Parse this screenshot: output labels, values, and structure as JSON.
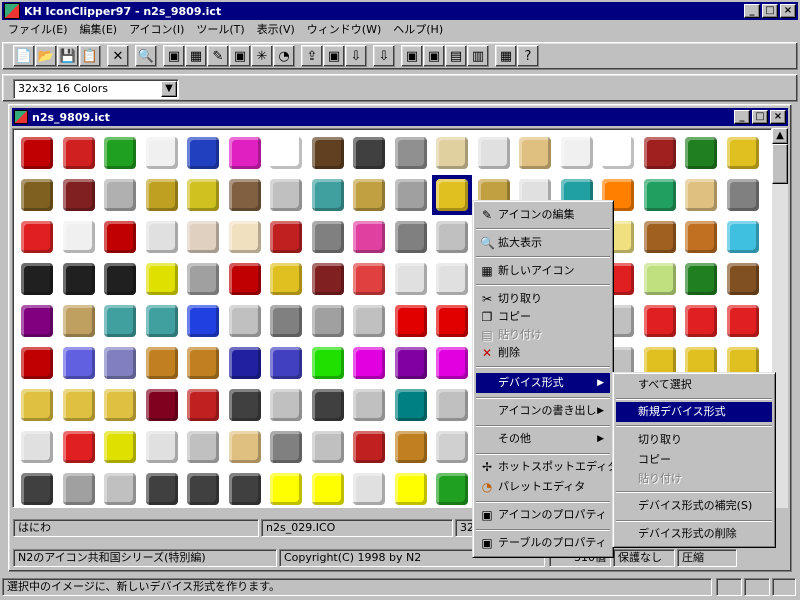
{
  "app": {
    "title": "KH IconClipper97 - n2s_9809.ict",
    "controls": [
      "_",
      "□",
      "×"
    ]
  },
  "menubar": [
    "ファイル(E)",
    "編集(E)",
    "アイコン(I)",
    "ツール(T)",
    "表示(V)",
    "ウィンドウ(W)",
    "ヘルプ(H)"
  ],
  "format_select": {
    "value": "32x32  16 Colors"
  },
  "child": {
    "title": "n2s_9809.ict",
    "controls": [
      "_",
      "□",
      "×"
    ]
  },
  "icon_rows": [
    [
      "#c00000",
      "#d02020",
      "#20a020",
      "#f0f0f0",
      "#2040c0",
      "#e020c0",
      "#ffffff",
      "#604020",
      "#404040",
      "#909090",
      "#e0d0a0",
      "#e0e0e0",
      "#e0c080",
      "#f0f0f0",
      "#ffffff",
      "#a02020",
      "#208020",
      "#e0c020"
    ],
    [
      "#806020",
      "#802020",
      "#b0b0b0",
      "#c0a020",
      "#d0c020",
      "#806040",
      "#c0c0c0",
      "#40a0a0",
      "#c0a040",
      "#a0a0a0",
      "#e0c020",
      "#c0a040",
      "#e0e0e0",
      "#20a0a0",
      "#ff8000",
      "#20a060",
      "#e0c080",
      "#808080"
    ],
    [
      "#e02020",
      "#f0f0f0",
      "#c00000",
      "#e0e0e0",
      "#e0d0c0",
      "#f0e0c0",
      "#c02020",
      "#808080",
      "#e040a0",
      "#808080",
      "#c0c0c0",
      "#e0c080",
      "#e0c080",
      "#e0c080",
      "#f0e080",
      "#a06020",
      "#c07020",
      "#40c0e0"
    ],
    [
      "#202020",
      "#202020",
      "#202020",
      "#e0e000",
      "#a0a0a0",
      "#c00000",
      "#e0c020",
      "#802020",
      "#e04040",
      "#e0e0e0",
      "#e0e0e0",
      "#e0e0e0",
      "#e0e0e0",
      "#e0e0e0",
      "#e02020",
      "#c0e080",
      "#208020",
      "#805020"
    ],
    [
      "#800080",
      "#c0a060",
      "#40a0a0",
      "#40a0a0",
      "#2040e0",
      "#c0c0c0",
      "#808080",
      "#a0a0a0",
      "#c0c0c0",
      "#e00000",
      "#e00000",
      "#2020e0",
      "#d0d0d0",
      "#c0c0c0",
      "#c0c0c0",
      "#e02020",
      "#e02020",
      "#e02020"
    ],
    [
      "#c00000",
      "#6060e0",
      "#8080c0",
      "#c08020",
      "#c08020",
      "#2020a0",
      "#4040c0",
      "#20e000",
      "#e000e0",
      "#8000a0",
      "#e000e0",
      "#c0c0c0",
      "#c0c0c0",
      "#c0c0c0",
      "#c0c0c0",
      "#e0c020",
      "#e0c020",
      "#e0c020"
    ],
    [
      "#e0c040",
      "#e0c040",
      "#e0c040",
      "#800020",
      "#c02020",
      "#404040",
      "#c0c0c0",
      "#404040",
      "#c0c0c0",
      "#008080",
      "#c0c0c0",
      "#c0c0c0",
      "#c0c0c0",
      "#c0c0c0",
      "#c0c0c0",
      "#c0c0c0",
      "#c0c0c0",
      "#c0c0c0"
    ],
    [
      "#e0e0e0",
      "#e02020",
      "#e0e000",
      "#e0e0e0",
      "#c0c0c0",
      "#e0c080",
      "#808080",
      "#c0c0c0",
      "#c02020",
      "#c08020",
      "#d0d0d0",
      "#c0c0c0",
      "#c0c0c0",
      "#c0c0c0",
      "#c0c0c0",
      "#c0c0c0",
      "#c0c0c0",
      "#c0c0c0"
    ],
    [
      "#404040",
      "#a0a0a0",
      "#c0c0c0",
      "#404040",
      "#404040",
      "#404040",
      "#ffff00",
      "#ffff00",
      "#e0e0e0",
      "#ffff00",
      "#20a020",
      "#c0c0c0",
      "#c0c0c0",
      "#c0c0c0",
      "#c0c0c0",
      "#c0c0c0",
      "#c0c0c0",
      "#c0c0c0"
    ]
  ],
  "status_row1": [
    "はにわ",
    "n2s_029.ICO",
    "32"
  ],
  "status_row2": [
    "N2のアイコン共和国シリーズ(特別編)",
    "Copyright(C) 1998 by N2",
    "310個",
    "保護なし",
    "圧縮"
  ],
  "statusbar": "選択中のイメージに、新しいデバイス形式を作ります。",
  "context_menu": {
    "items": [
      {
        "label": "アイコンの編集",
        "icon": "pencil-icon",
        "glyph": "✎"
      },
      {
        "label": "拡大表示",
        "icon": "magnifier-icon",
        "glyph": "🔍"
      },
      {
        "label": "新しいアイコン",
        "icon": "new-icon",
        "glyph": "▦"
      },
      {
        "label": "切り取り",
        "icon": "scissors-icon",
        "glyph": "✂"
      },
      {
        "label": "コピー",
        "icon": "copy-icon",
        "glyph": "❐"
      },
      {
        "label": "貼り付け",
        "icon": "paste-icon",
        "glyph": "▤"
      },
      {
        "label": "削除",
        "icon": "delete-icon",
        "glyph": "✕"
      },
      {
        "label": "デバイス形式",
        "submenu": true
      },
      {
        "label": "アイコンの書き出し",
        "submenu": true
      },
      {
        "label": "その他",
        "submenu": true
      },
      {
        "label": "ホットスポットエディタ",
        "icon": "hotspot-icon",
        "glyph": "✢"
      },
      {
        "label": "パレットエディタ",
        "icon": "palette-icon",
        "glyph": "◔"
      },
      {
        "label": "アイコンのプロパティ",
        "icon": "properties-icon",
        "glyph": "▣"
      },
      {
        "label": "テーブルのプロパティ",
        "icon": "table-properties-icon",
        "glyph": "▣"
      }
    ]
  },
  "submenu": {
    "items": [
      {
        "label": "すべて選択"
      },
      {
        "label": "新規デバイス形式"
      },
      {
        "label": "切り取り"
      },
      {
        "label": "コピー"
      },
      {
        "label": "貼り付け"
      },
      {
        "label": "デバイス形式の補完(S)"
      },
      {
        "label": "デバイス形式の削除"
      }
    ]
  },
  "toolbar_glyphs": [
    "📄",
    "📂",
    "💾",
    "📋",
    "✕",
    "🔍",
    "▣",
    "▦",
    "✎",
    "▣",
    "✳",
    "◔",
    "⇪",
    "▣",
    "⇩",
    "⇩",
    "▣",
    "▣",
    "▤",
    "▥",
    "▦",
    "?"
  ]
}
